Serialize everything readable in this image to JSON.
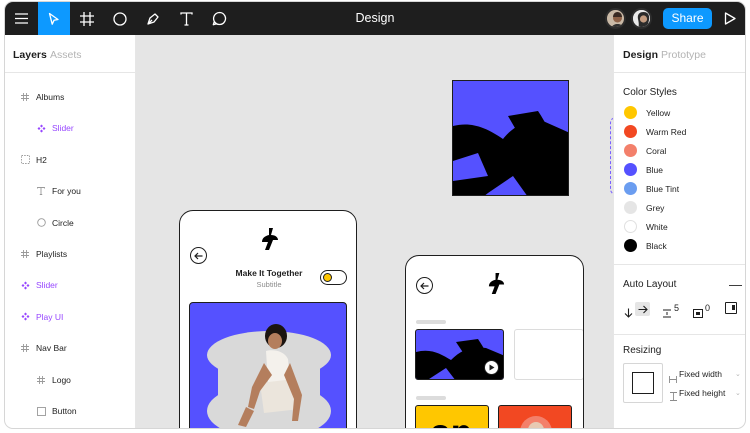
{
  "app": {
    "title": "Design"
  },
  "topbar": {
    "tools": [
      "menu-icon",
      "move-icon",
      "frame-icon",
      "ellipse-icon",
      "pen-icon",
      "text-icon",
      "comment-icon"
    ],
    "share_label": "Share"
  },
  "left_panel": {
    "tabs": {
      "layers": "Layers",
      "assets": "Assets"
    },
    "layers": [
      {
        "label": "Albums",
        "icon": "frame-icon",
        "indent": 0,
        "component": false
      },
      {
        "label": "Slider",
        "icon": "component-icon",
        "indent": 1,
        "component": true
      },
      {
        "label": "H2",
        "icon": "group-icon",
        "indent": 0,
        "component": false
      },
      {
        "label": "For you",
        "icon": "text-icon",
        "indent": 1,
        "component": false
      },
      {
        "label": "Circle",
        "icon": "ellipse-icon",
        "indent": 1,
        "component": false
      },
      {
        "label": "Playlists",
        "icon": "frame-icon",
        "indent": 0,
        "component": false
      },
      {
        "label": "Slider",
        "icon": "component-icon",
        "indent": 0,
        "component": true
      },
      {
        "label": "Play UI",
        "icon": "component-icon",
        "indent": 0,
        "component": true
      },
      {
        "label": "Nav Bar",
        "icon": "frame-icon",
        "indent": 0,
        "component": false
      },
      {
        "label": "Logo",
        "icon": "frame-icon",
        "indent": 1,
        "component": false
      },
      {
        "label": "Button",
        "icon": "rectangle-icon",
        "indent": 1,
        "component": false
      }
    ]
  },
  "right_panel": {
    "tabs": {
      "design": "Design",
      "prototype": "Prototype"
    },
    "color_styles": {
      "heading": "Color Styles",
      "items": [
        {
          "label": "Yellow",
          "color": "#ffc700"
        },
        {
          "label": "Warm Red",
          "color": "#f24822"
        },
        {
          "label": "Coral",
          "color": "#f3806b"
        },
        {
          "label": "Blue",
          "color": "#5551ff"
        },
        {
          "label": "Blue Tint",
          "color": "#6b9df0"
        },
        {
          "label": "Grey",
          "color": "#e5e5e5"
        },
        {
          "label": "White",
          "color": "#ffffff"
        },
        {
          "label": "Black",
          "color": "#000000"
        }
      ]
    },
    "auto_layout": {
      "heading": "Auto Layout",
      "spacing": "5",
      "padding": "0"
    },
    "resizing": {
      "heading": "Resizing",
      "width_label": "Fixed width",
      "height_label": "Fixed height"
    }
  },
  "canvas": {
    "phone1": {
      "title": "Make It Together",
      "subtitle": "Subtitle"
    }
  },
  "colors": {
    "accent": "#0d99ff",
    "component": "#9747ff",
    "brand_blue": "#5551ff",
    "canvas": "#e5e5e5"
  }
}
